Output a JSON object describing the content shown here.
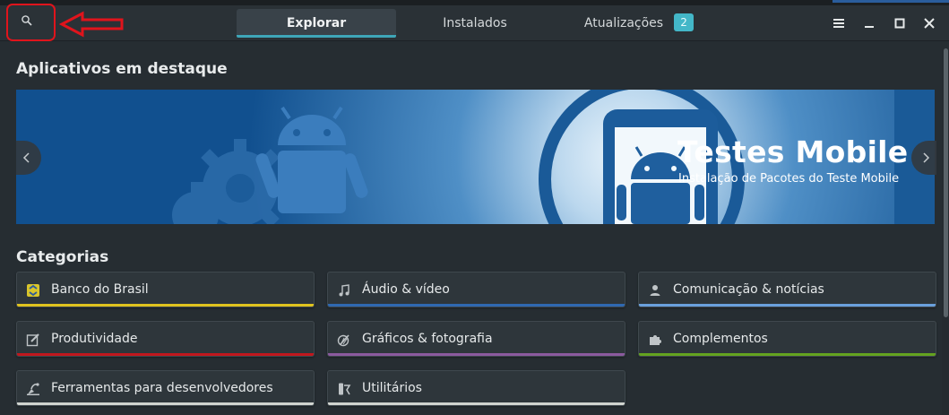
{
  "header": {
    "tabs": [
      {
        "label": "Explorar",
        "active": true
      },
      {
        "label": "Instalados",
        "active": false
      },
      {
        "label": "Atualizações",
        "active": false,
        "badge": "2"
      }
    ],
    "icons": [
      "search-icon",
      "menu-icon",
      "minimize-icon",
      "maximize-icon",
      "close-icon"
    ]
  },
  "featured": {
    "title": "Aplicativos em destaque",
    "banner_title": "Testes Mobile",
    "banner_subtitle": "Instalação de Pacotes do Teste Mobile"
  },
  "categories": {
    "title": "Categorias",
    "items": [
      {
        "label": "Banco do Brasil",
        "icon": "bank-icon",
        "color": "#e0c31e"
      },
      {
        "label": "Áudio & vídeo",
        "icon": "music-note-icon",
        "color": "#2f68b0"
      },
      {
        "label": "Comunicação & notícias",
        "icon": "person-icon",
        "color": "#6aa0dc"
      },
      {
        "label": "Produtividade",
        "icon": "edit-icon",
        "color": "#c1171d"
      },
      {
        "label": "Gráficos & fotografia",
        "icon": "graphics-icon",
        "color": "#8b5a9e"
      },
      {
        "label": "Complementos",
        "icon": "puzzle-icon",
        "color": "#64a31f"
      },
      {
        "label": "Ferramentas para desenvolvedores",
        "icon": "tools-icon",
        "color": "#d0d3cf"
      },
      {
        "label": "Utilitários",
        "icon": "utilities-icon",
        "color": "#d0d3cf"
      }
    ]
  },
  "colors": {
    "accent": "#3ea6b8",
    "badge": "#43b7c8",
    "annotation": "#e0141c",
    "banner": "#1a5a97"
  }
}
